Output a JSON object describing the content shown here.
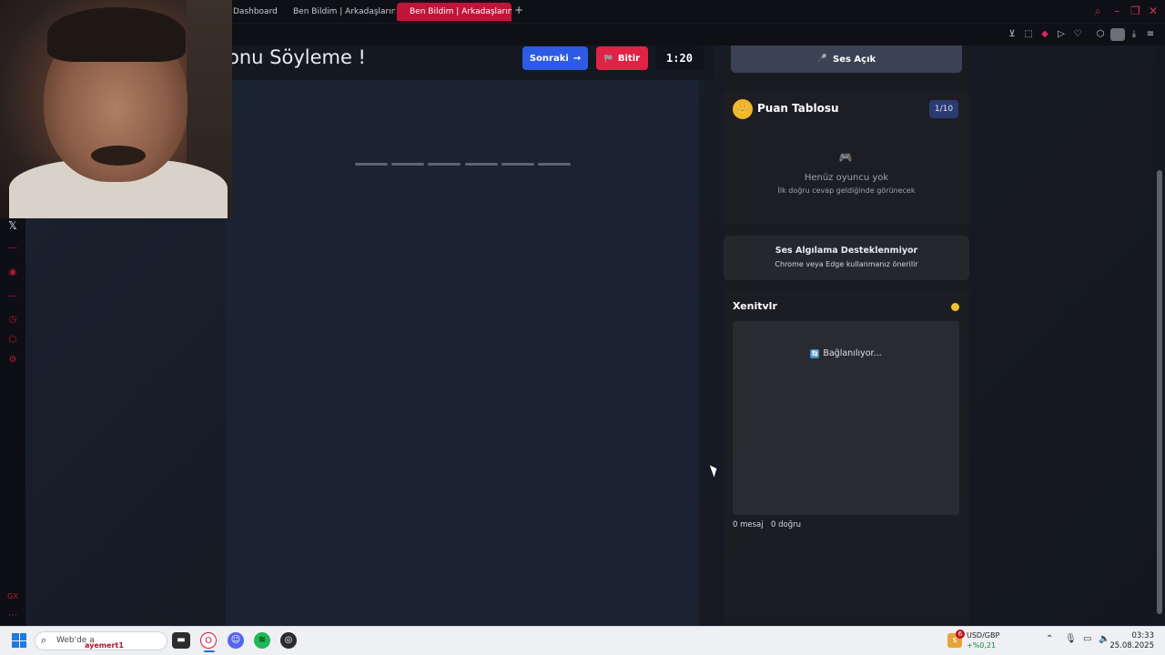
{
  "browser": {
    "tabs": [
      {
        "label": "Dashboard"
      },
      {
        "label": "Ben Bildim | Arkadaşlarını"
      },
      {
        "label": "Ben Bildim | Arkadaşlarını",
        "active": true
      }
    ],
    "new_tab": "+",
    "accent": "#c0153a"
  },
  "game": {
    "title": "onu Söyleme !",
    "next_label": "Sonraki",
    "next_arrow": "→",
    "finish_label": "Bitir",
    "finish_icon": "🏁",
    "timer": "1:20",
    "answer_slots": 6
  },
  "sound": {
    "icon": "🎤",
    "label": "Ses Açık"
  },
  "leaderboard": {
    "icon": "👑",
    "title": "Puan Tablosu",
    "count": "1/10",
    "empty_icon": "🎮",
    "empty_title": "Henüz oyuncu yok",
    "empty_sub": "İlk doğru cevap geldiğinde görünecek"
  },
  "voice_notice": {
    "title": "Ses Algılama Desteklenmiyor",
    "sub": "Chrome veya Edge kullanmanız önerilir"
  },
  "chat": {
    "title": "Xenitvlr",
    "status_icon": "🔄",
    "status": "Bağlanılıyor...",
    "messages": "0 mesaj",
    "correct": "0 doğru",
    "dot_color": "#f2c12e"
  },
  "taskbar": {
    "search_placeholder": "Web'de a",
    "search_user": "ayemert1",
    "stock_name": "USD/GBP",
    "stock_value": "+%0,21",
    "stock_badge": "6",
    "time": "03:33",
    "date": "25.08.2025"
  }
}
